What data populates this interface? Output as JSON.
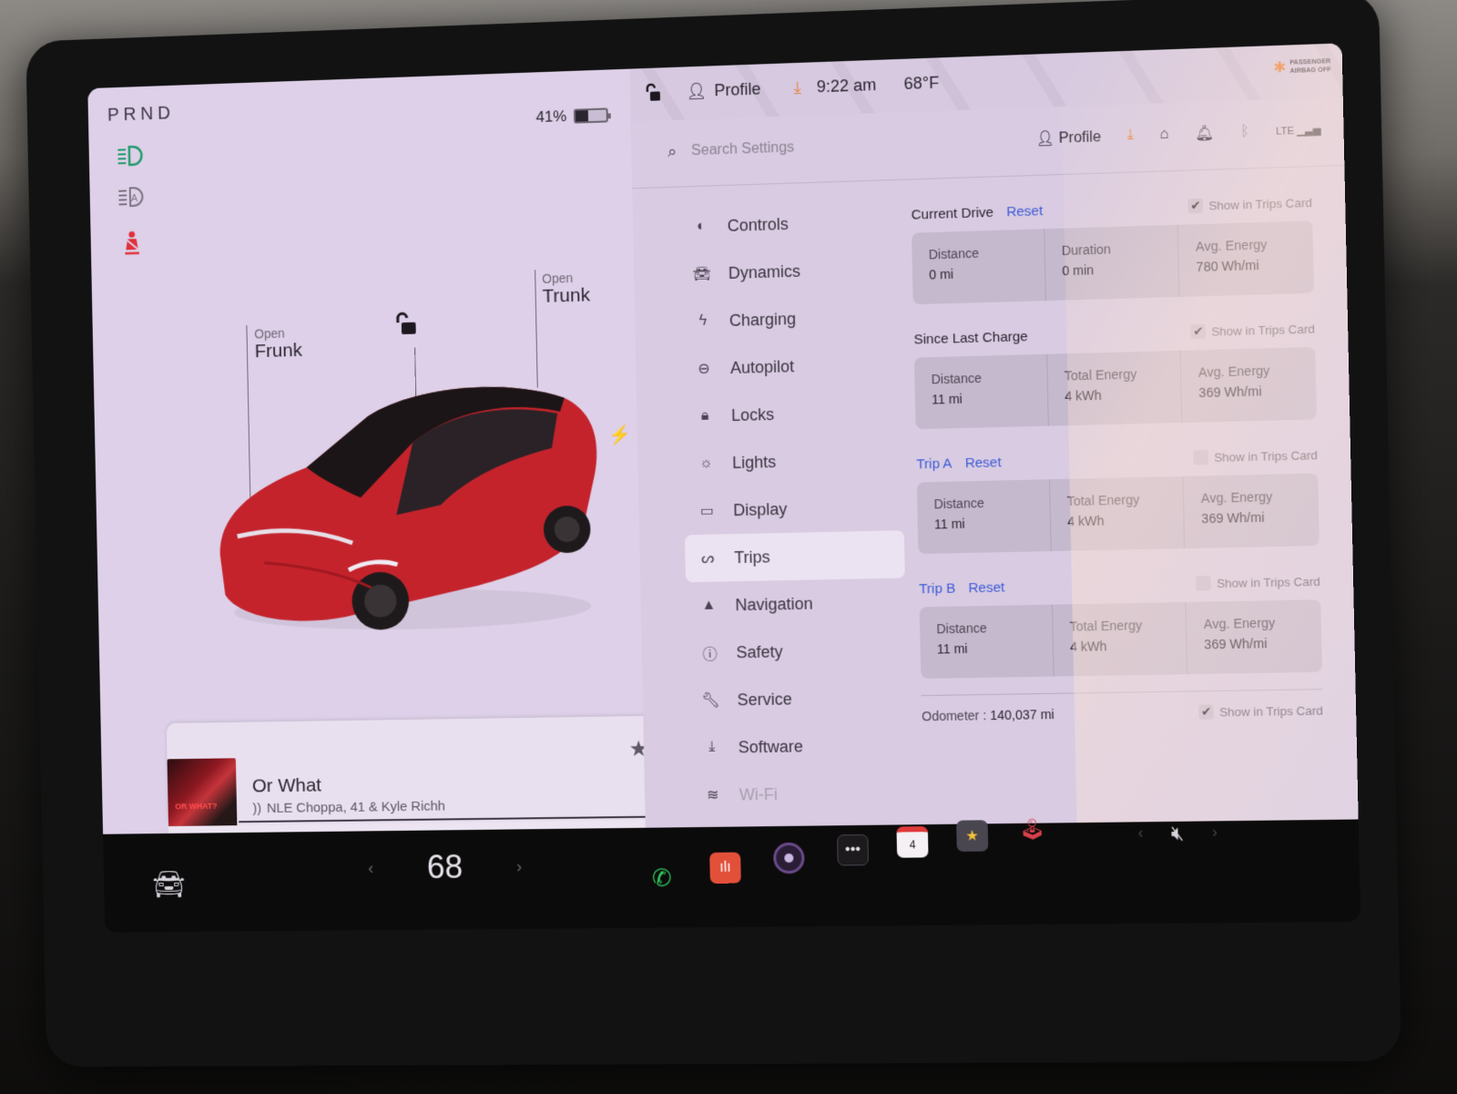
{
  "status": {
    "gear": "PRND",
    "battery_percent_label": "41%",
    "battery_level": 0.41,
    "time": "9:22 am",
    "temperature": "68°F",
    "profile": "Profile",
    "airbag_line1": "PASSENGER",
    "airbag_line2": "AIRBAG OFF"
  },
  "car": {
    "frunk_small": "Open",
    "frunk_big": "Frunk",
    "trunk_small": "Open",
    "trunk_big": "Trunk",
    "paint_color": "#c4232c"
  },
  "icons": {
    "headlights": "headlight-icon",
    "auto_highbeam": "auto-highbeam-icon",
    "seatbelt": "seatbelt-warning-icon",
    "lock": "unlocked-icon",
    "charge": "lightning-icon"
  },
  "media": {
    "title": "Or What",
    "artist": "NLE Choppa, 41 & Kyle Richh",
    "album_text": "OR WHAT?",
    "progress": 1.0
  },
  "settings": {
    "search_placeholder": "Search Settings",
    "profile_label": "Profile",
    "nav": [
      {
        "label": "Controls",
        "icon": "toggle-icon"
      },
      {
        "label": "Dynamics",
        "icon": "car-icon"
      },
      {
        "label": "Charging",
        "icon": "lightning-icon"
      },
      {
        "label": "Autopilot",
        "icon": "steering-wheel-icon"
      },
      {
        "label": "Locks",
        "icon": "lock-icon"
      },
      {
        "label": "Lights",
        "icon": "light-icon"
      },
      {
        "label": "Display",
        "icon": "display-icon"
      },
      {
        "label": "Trips",
        "icon": "trips-icon",
        "active": true
      },
      {
        "label": "Navigation",
        "icon": "navigation-icon"
      },
      {
        "label": "Safety",
        "icon": "safety-icon"
      },
      {
        "label": "Service",
        "icon": "wrench-icon"
      },
      {
        "label": "Software",
        "icon": "download-icon"
      },
      {
        "label": "Wi-Fi",
        "icon": "wifi-icon"
      }
    ],
    "show_in_trips_card": "Show in Trips Card",
    "reset": "Reset",
    "sections": [
      {
        "title": "Current Drive",
        "has_reset": true,
        "checked": true,
        "stats": [
          {
            "label": "Distance",
            "value": "0 mi"
          },
          {
            "label": "Duration",
            "value": "0 min"
          },
          {
            "label": "Avg. Energy",
            "value": "780 Wh/mi"
          }
        ]
      },
      {
        "title": "Since Last Charge",
        "has_reset": false,
        "checked": true,
        "stats": [
          {
            "label": "Distance",
            "value": "11 mi"
          },
          {
            "label": "Total Energy",
            "value": "4 kWh"
          },
          {
            "label": "Avg. Energy",
            "value": "369 Wh/mi"
          }
        ]
      },
      {
        "title": "Trip A",
        "has_reset": true,
        "checked": false,
        "stats": [
          {
            "label": "Distance",
            "value": "11 mi"
          },
          {
            "label": "Total Energy",
            "value": "4 kWh"
          },
          {
            "label": "Avg. Energy",
            "value": "369 Wh/mi"
          }
        ]
      },
      {
        "title": "Trip B",
        "has_reset": true,
        "checked": false,
        "stats": [
          {
            "label": "Distance",
            "value": "11 mi"
          },
          {
            "label": "Total Energy",
            "value": "4 kWh"
          },
          {
            "label": "Avg. Energy",
            "value": "369 Wh/mi"
          }
        ]
      }
    ],
    "odometer_label": "Odometer :",
    "odometer_value": "140,037 mi",
    "odometer_checked": true
  },
  "dock": {
    "cabin_temp": "68",
    "calendar_day": "4",
    "apps": [
      "phone",
      "voice-memo",
      "camera",
      "more",
      "calendar",
      "toybox",
      "arcade"
    ]
  },
  "colors": {
    "accent_blue": "#3d5bd6",
    "warning_red": "#e0303b",
    "headlight_green": "#1f9a6a",
    "download_orange": "#e8823a"
  }
}
